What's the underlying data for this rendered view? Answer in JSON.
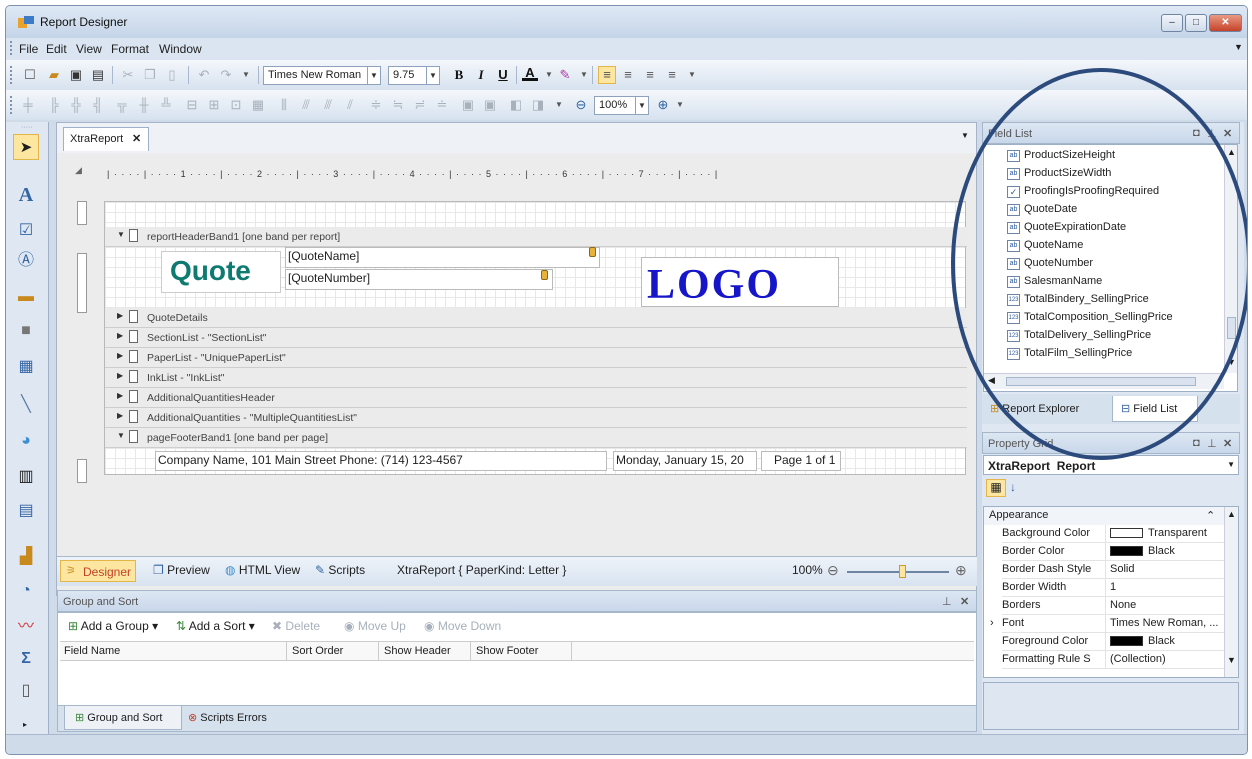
{
  "window": {
    "title": "Report Designer",
    "min": "–",
    "max": "□",
    "close": "✕"
  },
  "menu": [
    {
      "label": "File"
    },
    {
      "label": "Edit"
    },
    {
      "label": "View"
    },
    {
      "label": "Format"
    },
    {
      "label": "Window"
    }
  ],
  "toolbar": {
    "font": "Times New Roman",
    "size": "9.75",
    "bold": "B",
    "italic": "I",
    "underline": "U",
    "zoom": "100%"
  },
  "doc": {
    "tab": "XtraReport",
    "ruler": "| · · · · | · · · · 1 · · · · | · · · · 2 · · · · | · · · · 3 · · · · | · · · · 4 · · · · | · · · · 5 · · · · | · · · · 6 · · · · | · · · · 7 · · · · | · · · · |",
    "bands": [
      "reportHeaderBand1 [one band per report]",
      "QuoteDetails",
      "SectionList - \"SectionList\"",
      "PaperList - \"UniquePaperList\"",
      "InkList - \"InkList\"",
      "AdditionalQuantitiesHeader",
      "AdditionalQuantities - \"MultipleQuantitiesList\"",
      "pageFooterBand1 [one band per page]"
    ],
    "quote": "Quote",
    "quote_name": "[QuoteName]",
    "quote_number": "[QuoteNumber]",
    "logo": "LOGO",
    "footer_company": "Company Name,  101 Main Street  Phone: (714) 123-4567",
    "footer_date": "Monday, January 15, 20",
    "footer_page": "Page 1 of 1"
  },
  "viewbar": {
    "designer": "Designer",
    "preview": "Preview",
    "html": "HTML View",
    "scripts": "Scripts",
    "status": "XtraReport { PaperKind: Letter }",
    "zoom": "100%",
    "zoom_level": 0.55
  },
  "group_sort": {
    "title": "Group and Sort",
    "add_group": "Add a Group",
    "add_sort": "Add a Sort",
    "delete": "Delete",
    "move_up": "Move Up",
    "move_down": "Move Down",
    "columns": [
      "Field Name",
      "Sort Order",
      "Show Header",
      "Show Footer"
    ],
    "tabs": [
      "Group and Sort",
      "Scripts Errors"
    ]
  },
  "field_list": {
    "title": "Field List",
    "items": [
      {
        "label": "ProductSizeHeight",
        "icon": "ab"
      },
      {
        "label": "ProductSizeWidth",
        "icon": "ab"
      },
      {
        "label": "ProofingIsProofingRequired",
        "icon": "✓"
      },
      {
        "label": "QuoteDate",
        "icon": "ab"
      },
      {
        "label": "QuoteExpirationDate",
        "icon": "ab"
      },
      {
        "label": "QuoteName",
        "icon": "ab"
      },
      {
        "label": "QuoteNumber",
        "icon": "ab"
      },
      {
        "label": "SalesmanName",
        "icon": "ab"
      },
      {
        "label": "TotalBindery_SellingPrice",
        "icon": "123"
      },
      {
        "label": "TotalComposition_SellingPrice",
        "icon": "123"
      },
      {
        "label": "TotalDelivery_SellingPrice",
        "icon": "123"
      },
      {
        "label": "TotalFilm_SellingPrice",
        "icon": "123"
      }
    ],
    "tabs": [
      "Report Explorer",
      "Field List"
    ]
  },
  "property_grid": {
    "title": "Property Grid",
    "object": "XtraReport",
    "object_type": "Report",
    "category": "Appearance",
    "rows": [
      {
        "name": "Background Color",
        "value": "Transparent",
        "swatch": "#ffffff"
      },
      {
        "name": "Border Color",
        "value": "Black",
        "swatch": "#000000"
      },
      {
        "name": "Border Dash Style",
        "value": "Solid",
        "swatch": ""
      },
      {
        "name": "Border Width",
        "value": "1",
        "swatch": ""
      },
      {
        "name": "Borders",
        "value": "None",
        "swatch": ""
      },
      {
        "name": "Font",
        "value": "Times New Roman, ...",
        "swatch": ""
      },
      {
        "name": "Foreground Color",
        "value": "Black",
        "swatch": "#000000"
      },
      {
        "name": "Formatting Rule S",
        "value": "(Collection)",
        "swatch": ""
      }
    ]
  },
  "colors": {
    "accent": "#2c4b7c",
    "highlight": "#fce6a0",
    "quote_text": "#0e7a70",
    "logo_text": "#1616c8"
  }
}
